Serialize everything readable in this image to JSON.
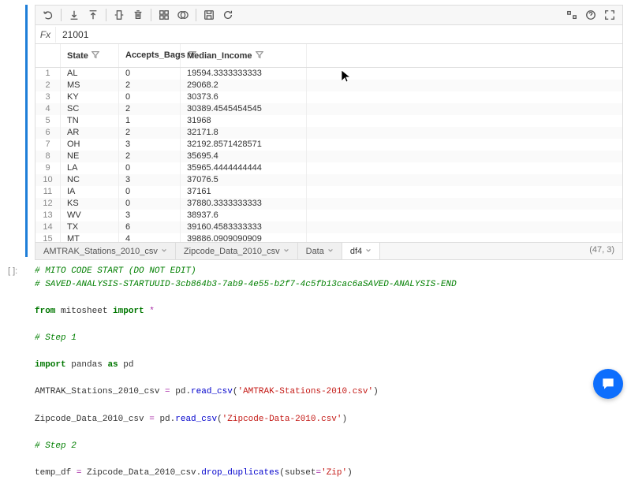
{
  "fxbar": {
    "label": "Fx",
    "value": "21001"
  },
  "columns": {
    "state": "State",
    "bags": "Accepts_Bags",
    "median": "Median_Income"
  },
  "rows": [
    {
      "idx": "1",
      "state": "AL",
      "bags": "0",
      "median": "19594.3333333333"
    },
    {
      "idx": "2",
      "state": "MS",
      "bags": "2",
      "median": "29068.2"
    },
    {
      "idx": "3",
      "state": "KY",
      "bags": "0",
      "median": "30373.6"
    },
    {
      "idx": "4",
      "state": "SC",
      "bags": "2",
      "median": "30389.4545454545"
    },
    {
      "idx": "5",
      "state": "TN",
      "bags": "1",
      "median": "31968"
    },
    {
      "idx": "6",
      "state": "AR",
      "bags": "2",
      "median": "32171.8"
    },
    {
      "idx": "7",
      "state": "OH",
      "bags": "3",
      "median": "32192.8571428571"
    },
    {
      "idx": "8",
      "state": "NE",
      "bags": "2",
      "median": "35695.4"
    },
    {
      "idx": "9",
      "state": "LA",
      "bags": "0",
      "median": "35965.4444444444"
    },
    {
      "idx": "10",
      "state": "NC",
      "bags": "3",
      "median": "37076.5"
    },
    {
      "idx": "11",
      "state": "IA",
      "bags": "0",
      "median": "37161"
    },
    {
      "idx": "12",
      "state": "KS",
      "bags": "0",
      "median": "37880.3333333333"
    },
    {
      "idx": "13",
      "state": "WV",
      "bags": "3",
      "median": "38937.6"
    },
    {
      "idx": "14",
      "state": "TX",
      "bags": "6",
      "median": "39160.4583333333"
    },
    {
      "idx": "15",
      "state": "MT",
      "bags": "4",
      "median": "39886.0909090909"
    }
  ],
  "tabs": {
    "items": [
      {
        "label": "AMTRAK_Stations_2010_csv"
      },
      {
        "label": "Zipcode_Data_2010_csv"
      },
      {
        "label": "Data"
      },
      {
        "label": "df4"
      }
    ],
    "shape": "(47, 3)"
  },
  "code": {
    "l1": "# MITO CODE START (DO NOT EDIT)",
    "l2": "# SAVED-ANALYSIS-STARTUUID-3cb864b3-7ab9-4e55-b2f7-4c5fb13cac6aSAVED-ANALYSIS-END",
    "l3a": "from",
    "l3b": "mitosheet",
    "l3c": "import",
    "l3d": "*",
    "l4": "# Step 1",
    "l5a": "import",
    "l5b": "pandas",
    "l5c": "as",
    "l5d": "pd",
    "l6a": "AMTRAK_Stations_2010_csv ",
    "l6b": "=",
    "l6c": " pd.",
    "l6d": "read_csv",
    "l6e": "(",
    "l6f": "'AMTRAK-Stations-2010.csv'",
    "l6g": ")",
    "l7a": "Zipcode_Data_2010_csv ",
    "l7b": "=",
    "l7c": " pd.",
    "l7d": "read_csv",
    "l7e": "(",
    "l7f": "'Zipcode-Data-2010.csv'",
    "l7g": ")",
    "l8": "# Step 2",
    "l9a": "temp_df ",
    "l9b": "=",
    "l9c": " Zipcode_Data_2010_csv.",
    "l9d": "drop_duplicates",
    "l9e": "(subset",
    "l9f": "=",
    "l9g": "'Zip'",
    "l9h": ")"
  },
  "cell_prompt": "[ ]:"
}
